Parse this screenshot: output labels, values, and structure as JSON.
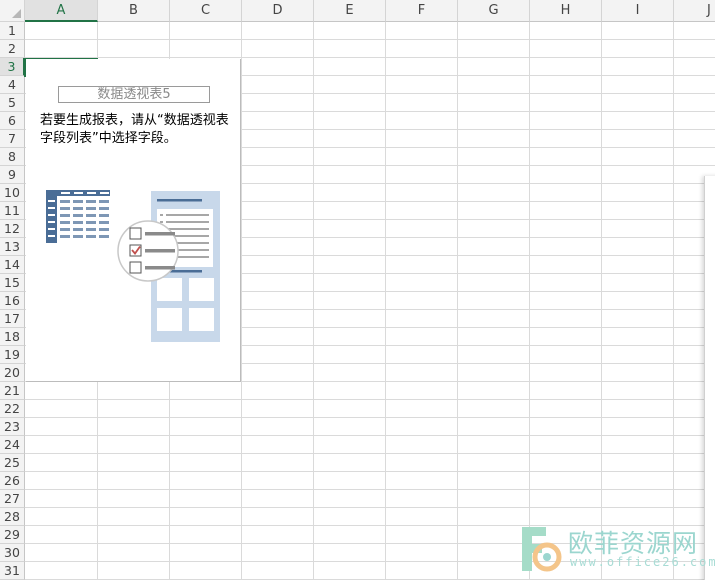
{
  "columns": [
    "A",
    "B",
    "C",
    "D",
    "E",
    "F",
    "G",
    "H",
    "I",
    "J"
  ],
  "rows": [
    "1",
    "2",
    "3",
    "4",
    "5",
    "6",
    "7",
    "8",
    "9",
    "10",
    "11",
    "12",
    "13",
    "14",
    "15",
    "16",
    "17",
    "18",
    "19",
    "20",
    "21",
    "22",
    "23",
    "24",
    "25",
    "26",
    "27",
    "28",
    "29",
    "30",
    "31"
  ],
  "active_cell": {
    "column": "A",
    "row": "3"
  },
  "pivot_table": {
    "name": "数据透视表5",
    "instructions": "若要生成报表，请从“数据透视表字段列表”中选择字段。"
  },
  "watermark": {
    "text": "欧菲资源网",
    "url": "www.office26.com"
  },
  "colors": {
    "accent": "#217346",
    "illustration_blue": "#5b7ea6",
    "illustration_light": "#c8d8ea",
    "checkmark": "#c0504d"
  }
}
